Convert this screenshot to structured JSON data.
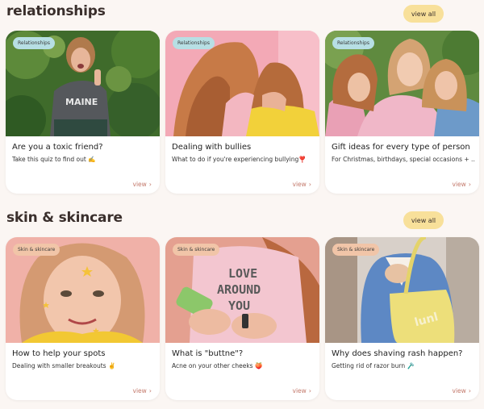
{
  "sections": [
    {
      "title": "relationships",
      "view_all_label": "view all",
      "cards": [
        {
          "badge": "Relationships",
          "title": "Are you a toxic friend?",
          "subtitle": "Take this quiz to find out ✍️",
          "view_label": "view"
        },
        {
          "badge": "Relationships",
          "title": "Dealing with bullies",
          "subtitle": "What to do if you're experiencing bullying❣️",
          "view_label": "view"
        },
        {
          "badge": "Relationships",
          "title": "Gift ideas for every type of person",
          "subtitle": "For Christmas, birthdays, special occasions + ...",
          "view_label": "view"
        }
      ]
    },
    {
      "title": "skin & skincare",
      "view_all_label": "view all",
      "cards": [
        {
          "badge": "Skin & skincare",
          "title": "How to help your spots",
          "subtitle": "Dealing with smaller breakouts ✌️",
          "view_label": "view"
        },
        {
          "badge": "Skin & skincare",
          "title": "What is \"buttne\"?",
          "subtitle": "Acne on your other cheeks 🍑",
          "view_label": "view"
        },
        {
          "badge": "Skin & skincare",
          "title": "Why does shaving rash happen?",
          "subtitle": "Getting rid of razor burn 🪒",
          "view_label": "view"
        }
      ]
    }
  ],
  "thumb_text": {
    "shirt_maine": "MAINE",
    "shirt_love": "LOVE",
    "shirt_around": "AROUND",
    "shirt_you": "YOU",
    "bag_brand": "lunl"
  },
  "colors": {
    "background": "#fbf6f3",
    "view_all_bg": "#f8e09a",
    "relationships_badge": "#b7dfe4",
    "skin_badge": "#f1c5a8",
    "view_link": "#c47a6c"
  }
}
